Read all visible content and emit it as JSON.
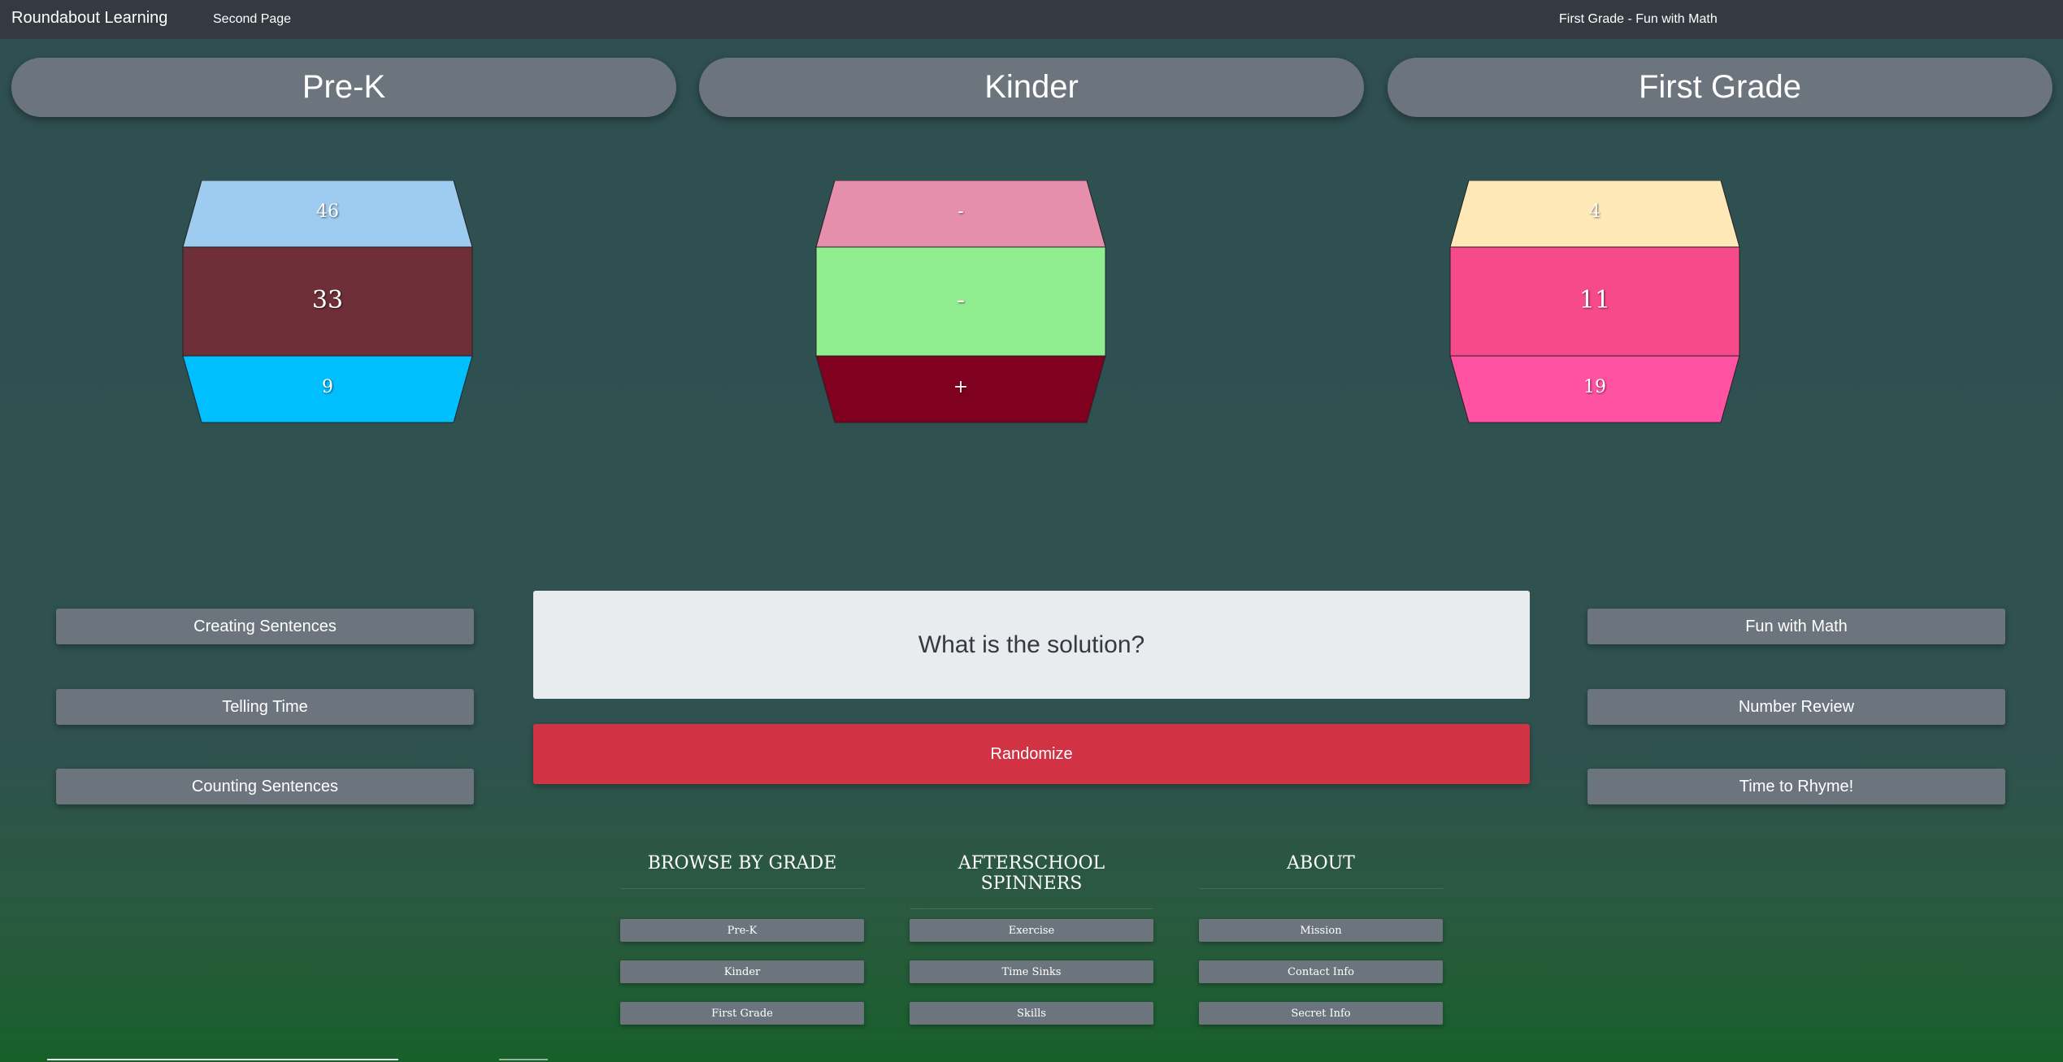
{
  "topbar": {
    "brand": "Roundabout Learning",
    "nav_second": "Second Page",
    "nav_right": "First Grade - Fun with Math"
  },
  "grades": [
    "Pre-K",
    "Kinder",
    "First Grade"
  ],
  "spinners": [
    {
      "top": "46",
      "middle": "33",
      "bottom": "9",
      "colors": {
        "top": "#9ecbf0",
        "middle": "#6e2f38",
        "bottom": "#00bfff"
      }
    },
    {
      "top": "-",
      "middle": "-",
      "bottom": "+",
      "colors": {
        "top": "#e68fac",
        "middle": "#90ee90",
        "bottom": "#800020"
      }
    },
    {
      "top": "4",
      "middle": "11",
      "bottom": "19",
      "colors": {
        "top": "#ffe8b8",
        "middle": "#f64a8a",
        "bottom": "#ff52a2"
      }
    }
  ],
  "left_buttons": [
    "Creating Sentences",
    "Telling Time",
    "Counting Sentences"
  ],
  "right_buttons": [
    "Fun with Math",
    "Number Review",
    "Time to Rhyme!"
  ],
  "question": "What is the solution?",
  "randomize_label": "Randomize",
  "footer": {
    "browse": {
      "heading": "BROWSE BY GRADE",
      "links": [
        "Pre-K",
        "Kinder",
        "First Grade"
      ]
    },
    "afterschool": {
      "heading": "AFTERSCHOOL SPINNERS",
      "links": [
        "Exercise",
        "Time Sinks",
        "Skills"
      ]
    },
    "about": {
      "heading": "ABOUT",
      "links": [
        "Mission",
        "Contact Info",
        "Secret Info"
      ]
    }
  },
  "colors": {
    "topbar": "#343a42",
    "pill": "#6c757d",
    "randomize": "#d23344",
    "question_bg": "#e8ecef"
  }
}
